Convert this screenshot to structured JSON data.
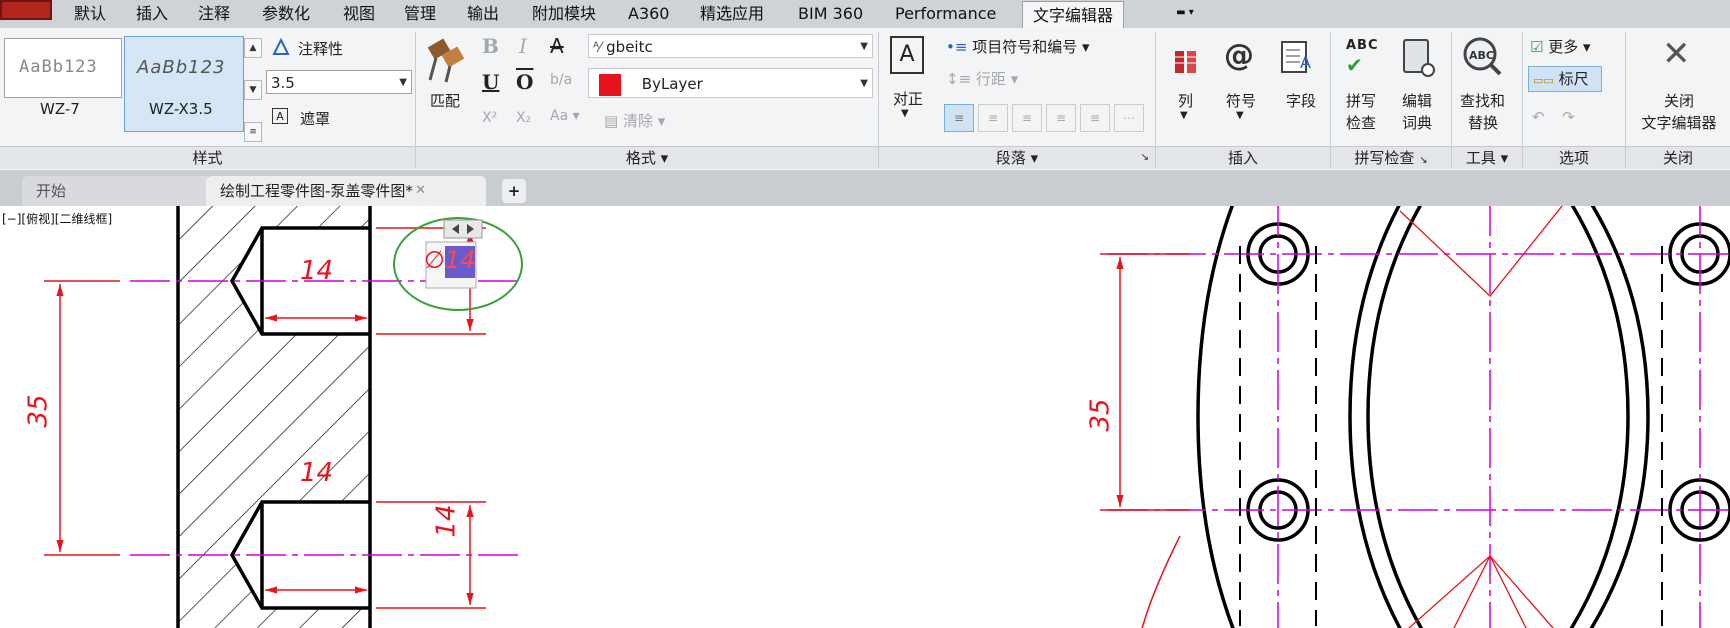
{
  "menubar": {
    "tabs": [
      "默认",
      "插入",
      "注释",
      "参数化",
      "视图",
      "管理",
      "输出",
      "附加模块",
      "A360",
      "精选应用",
      "BIM 360",
      "Performance",
      "文字编辑器"
    ],
    "active_tab": "文字编辑器"
  },
  "style_panel": {
    "styles": [
      {
        "preview": "AaBb123",
        "name": "WZ-7"
      },
      {
        "preview": "AaBb123",
        "name": "WZ-X3.5"
      }
    ],
    "annotative_label": "注释性",
    "height_value": "3.5",
    "mask_label": "遮罩",
    "panel_title": "样式"
  },
  "format_panel": {
    "match_label": "匹配",
    "bold": "B",
    "italic": "I",
    "strike": "A",
    "font_value": "gbeitc",
    "underline": "U",
    "overline": "O",
    "color_value": "ByLayer",
    "clear_label": "清除",
    "panel_title": "格式"
  },
  "paragraph_panel": {
    "justify_label": "对正",
    "bullets_label": "项目符号和编号",
    "line_spacing_label": "行距",
    "panel_title": "段落"
  },
  "insert_panel": {
    "columns_label": "列",
    "symbol_label": "符号",
    "field_label": "字段",
    "panel_title": "插入"
  },
  "spell_panel": {
    "spell_check_line1": "拼写",
    "spell_check_line2": "检查",
    "edit_dict_line1": "编辑",
    "edit_dict_line2": "词典",
    "panel_title": "拼写检查"
  },
  "tools_panel": {
    "find_line1": "查找和",
    "find_line2": "替换",
    "panel_title": "工具"
  },
  "options_panel": {
    "more_label": "更多",
    "ruler_label": "标尺",
    "panel_title": "选项"
  },
  "close_panel": {
    "close_line1": "关闭",
    "close_line2": "文字编辑器",
    "panel_title": "关闭"
  },
  "doc_tabs": {
    "start": "开始",
    "drawing": "绘制工程零件图-泵盖零件图*",
    "add": "+"
  },
  "canvas": {
    "viewport_label": "[−][俯视][二维线框]",
    "dim_14": "14",
    "dim_35": "35",
    "edit_text_prefix": "∅",
    "edit_text_value": "14"
  },
  "colors": {
    "dimension": "#e8141c",
    "centerline": "#d400d4",
    "edit_ring": "#3aa13a",
    "selection": "#6a5acd"
  }
}
